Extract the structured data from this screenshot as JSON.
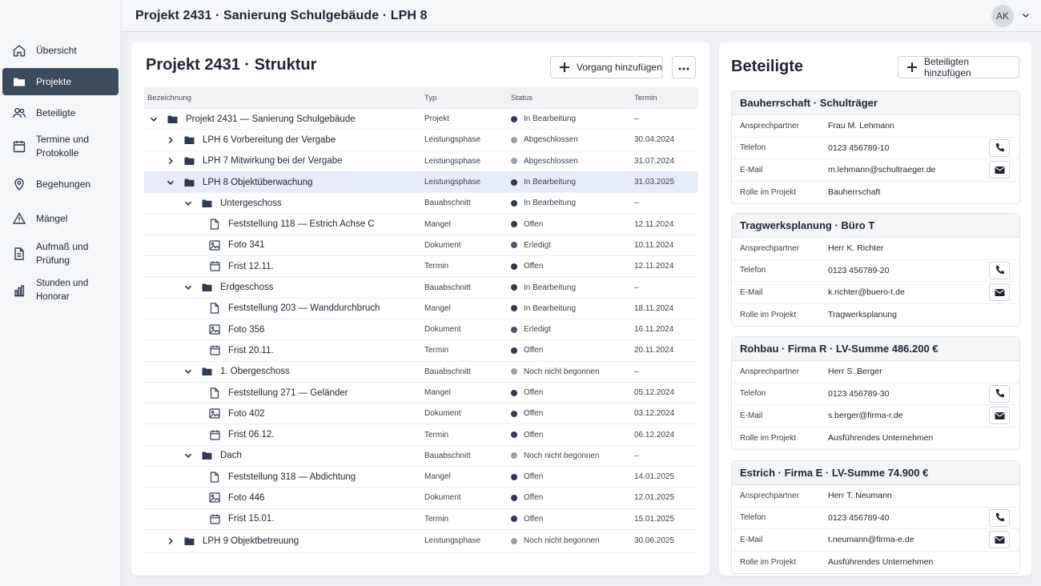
{
  "header": {
    "title": "Projekt 2431 · Sanierung Schulgebäude · LPH 8",
    "avatar": "AK"
  },
  "sidebar": {
    "items": [
      {
        "label": "Übersicht",
        "icon": "home-icon",
        "active": false
      },
      {
        "label": "Projekte",
        "icon": "folder-icon",
        "active": true
      },
      {
        "label": "Beteiligte",
        "icon": "users-icon",
        "active": false
      },
      {
        "label": "Termine und Protokolle",
        "icon": "calendar-icon",
        "active": false
      },
      {
        "label": "Begehungen",
        "icon": "map-pin-icon",
        "active": false
      },
      {
        "label": "Mängel",
        "icon": "warning-icon",
        "active": false
      },
      {
        "label": "Aufmaß und Prüfung",
        "icon": "document-icon",
        "active": false
      },
      {
        "label": "Stunden und Honorar",
        "icon": "bar-chart-icon",
        "active": false
      }
    ]
  },
  "structure": {
    "title": "Projekt 2431 · Struktur",
    "add_button": "Vorgang hinzufügen",
    "columns": {
      "name": "Bezeichnung",
      "type": "Typ",
      "status": "Status",
      "date": "Termin"
    },
    "rows": [
      {
        "label": "Projekt 2431 — Sanierung Schulgebäude",
        "type": "Projekt",
        "status": "In Bearbeitung",
        "date": "–"
      },
      {
        "label": "LPH 6 Vorbereitung der Vergabe",
        "type": "Leistungsphase",
        "status": "Abgeschlossen",
        "date": "30.04.2024"
      },
      {
        "label": "LPH 7 Mitwirkung bei der Vergabe",
        "type": "Leistungsphase",
        "status": "Abgeschlossen",
        "date": "31.07.2024"
      },
      {
        "label": "LPH 8 Objektüberwachung",
        "type": "Leistungsphase",
        "status": "In Bearbeitung",
        "date": "31.03.2025"
      },
      {
        "label": "Untergeschoss",
        "type": "Bauabschnitt",
        "status": "In Bearbeitung",
        "date": "–"
      },
      {
        "label": "Feststellung 118 — Estrich Achse C",
        "type": "Mangel",
        "status": "Offen",
        "date": "12.11.2024"
      },
      {
        "label": "Foto 341",
        "type": "Dokument",
        "status": "Erledigt",
        "date": "10.11.2024"
      },
      {
        "label": "Frist 12.11.",
        "type": "Termin",
        "status": "Offen",
        "date": "12.11.2024"
      },
      {
        "label": "Erdgeschoss",
        "type": "Bauabschnitt",
        "status": "In Bearbeitung",
        "date": "–"
      },
      {
        "label": "Feststellung 203 — Wanddurchbruch",
        "type": "Mangel",
        "status": "In Bearbeitung",
        "date": "18.11.2024"
      },
      {
        "label": "Foto 356",
        "type": "Dokument",
        "status": "Erledigt",
        "date": "16.11.2024"
      },
      {
        "label": "Frist 20.11.",
        "type": "Termin",
        "status": "Offen",
        "date": "20.11.2024"
      },
      {
        "label": "1. Obergeschoss",
        "type": "Bauabschnitt",
        "status": "Noch nicht begonnen",
        "date": "–"
      },
      {
        "label": "Feststellung 271 — Geländer",
        "type": "Mangel",
        "status": "Offen",
        "date": "05.12.2024"
      },
      {
        "label": "Foto 402",
        "type": "Dokument",
        "status": "Offen",
        "date": "03.12.2024"
      },
      {
        "label": "Frist 06.12.",
        "type": "Termin",
        "status": "Offen",
        "date": "06.12.2024"
      },
      {
        "label": "Dach",
        "type": "Bauabschnitt",
        "status": "Noch nicht begonnen",
        "date": "–"
      },
      {
        "label": "Feststellung 318 — Abdichtung",
        "type": "Mangel",
        "status": "Offen",
        "date": "14.01.2025"
      },
      {
        "label": "Foto 446",
        "type": "Dokument",
        "status": "Offen",
        "date": "12.01.2025"
      },
      {
        "label": "Frist 15.01.",
        "type": "Termin",
        "status": "Offen",
        "date": "15.01.2025"
      },
      {
        "label": "LPH 9 Objektbetreuung",
        "type": "Leistungsphase",
        "status": "Noch nicht begonnen",
        "date": "30.06.2025"
      }
    ]
  },
  "participants": {
    "title": "Beteiligte",
    "add_button": "Beteiligten hinzufügen",
    "labels": {
      "contact": "Ansprechpartner",
      "phone": "Telefon",
      "email": "E-Mail",
      "role": "Rolle im Projekt"
    },
    "cards": [
      {
        "title": "Bauherrschaft · Schulträger",
        "contact": "Frau M. Lehmann",
        "phone": "0123 456789-10",
        "email": "m.lehmann@schultraeger.de",
        "role": "Bauherrschaft"
      },
      {
        "title": "Tragwerksplanung · Büro T",
        "contact": "Herr K. Richter",
        "phone": "0123 456789-20",
        "email": "k.richter@buero-t.de",
        "role": "Tragwerksplanung"
      },
      {
        "title": "Rohbau · Firma R · LV-Summe 486.200 €",
        "contact": "Herr S. Berger",
        "phone": "0123 456789-30",
        "email": "s.berger@firma-r.de",
        "role": "Ausführendes Unternehmen"
      },
      {
        "title": "Estrich · Firma E · LV-Summe 74.900 €",
        "contact": "Herr T. Neumann",
        "phone": "0123 456789-40",
        "email": "t.neumann@firma-e.de",
        "role": "Ausführendes Unternehmen"
      }
    ]
  },
  "colors": {
    "active_nav": "#3c4a5e",
    "selected_row": "#e6edf6",
    "status_dark": "#2f3a4d",
    "status_gray": "#9aa0a8"
  }
}
